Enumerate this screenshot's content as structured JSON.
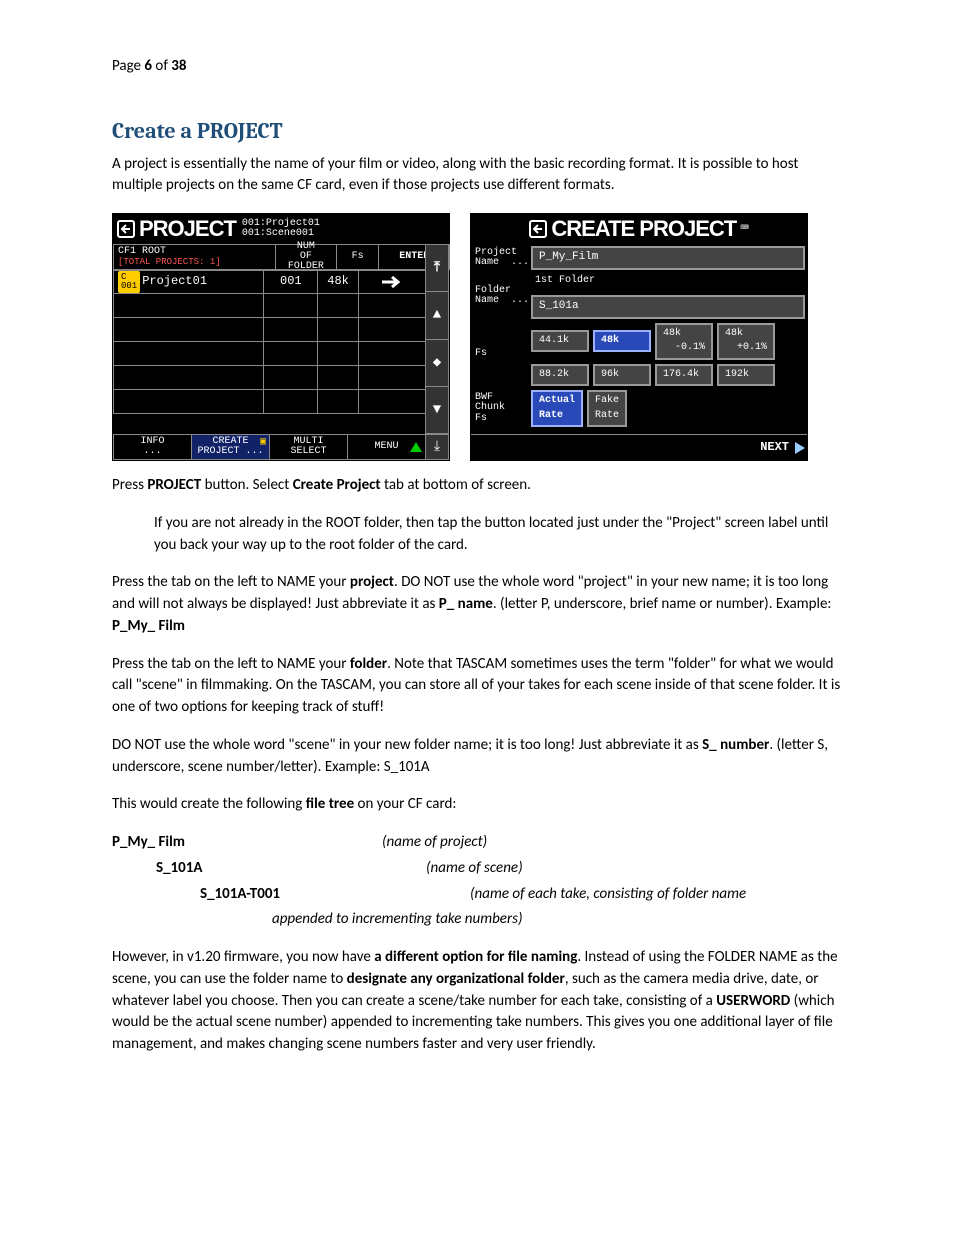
{
  "page": {
    "prefix": "Page ",
    "current": "6",
    "sep": " of ",
    "total": "38"
  },
  "heading": "Create a PROJECT",
  "intro": "A project is essentially the name of your film or video, along with the basic recording format. It is possible to host multiple projects on the same CF card, even if those projects use different formats.",
  "screen_left": {
    "title_big": "PROJECT",
    "title_sub1": "001:Project01",
    "title_sub2": "001:Scene001",
    "header": {
      "root_line1": "CF1 ROOT",
      "root_line2": "[TOTAL PROJECTS:  1]",
      "num_of_folder": "NUM\nOF\nFOLDER",
      "fs": "Fs",
      "enter": "ENTER"
    },
    "row1": {
      "badge": "C\n001",
      "name": "Project01",
      "num": "001",
      "fs": "48k"
    },
    "footer": {
      "info": "INFO\n...",
      "create": "CREATE\nPROJECT ...",
      "multi": "MULTI\nSELECT",
      "menu": "MENU"
    }
  },
  "screen_right": {
    "title_big": "CREATE PROJECT",
    "project_label": "Project\nName  ...",
    "project_value": "P_My_Film",
    "folder_label": "Folder\nName  ...",
    "folder_topline": "1st Folder",
    "folder_value": "S_101a",
    "fs_label": "Fs",
    "fs_opts": [
      "44.1k",
      "48k",
      "48k\n  -0.1%",
      "48k\n  +0.1%",
      "88.2k",
      "96k",
      "176.4k",
      "192k"
    ],
    "fs_selected_index": 1,
    "bwf_label": "BWF\nChunk\nFs",
    "bwf_opts": [
      "Actual\nRate",
      "Fake\nRate"
    ],
    "bwf_selected_index": 0,
    "next": "NEXT"
  },
  "p_press": {
    "a": "Press ",
    "b": "PROJECT",
    "c": " button. Select ",
    "d": "Create Project",
    "e": " tab at bottom of screen."
  },
  "p_root": "If you are not already in the ROOT folder, then tap the button located just under the \"Project\" screen label until you back your way up to the root folder of the card.",
  "p_name1": {
    "a": "Press the tab on the left to NAME your ",
    "b": "project",
    "c": ". DO NOT use the whole word \"project\" in your new name; it is too long and will not always be displayed! Just abbreviate it as ",
    "d": "P_ name",
    "e": ".  (letter P, underscore, brief name or number). Example: ",
    "f": "P_My_ Film"
  },
  "p_name2": {
    "a": "Press the tab on the left to NAME your ",
    "b": "folder",
    "c": ". Note that TASCAM sometimes uses the term \"folder\" for what we would call \"scene\" in filmmaking. On the TASCAM, you can store all of your takes for each scene inside of that scene folder. It is one of two options for keeping track of stuff!"
  },
  "p_scene": {
    "a": "DO NOT use the whole word \"scene\" in your new folder name; it is too long! Just abbreviate it as ",
    "b": "S_ number",
    "c": ".  (letter S, underscore, scene number/letter). Example: S_101A"
  },
  "p_tree_intro": {
    "a": "This would create the following ",
    "b": "file tree",
    "c": " on your CF card:"
  },
  "tree": {
    "l1": "P_My_ Film",
    "d1": "(name of project)",
    "l2": "S_101A",
    "d2": "(name of scene)",
    "l3": "S_101A-T001",
    "d3": "(name of each take, consisting of folder name",
    "d3b": "appended to incrementing take numbers)"
  },
  "p_firmware": {
    "a": "However, in v1.20 firmware, you now have ",
    "b": "a different option for file naming",
    "c": ". Instead of using the FOLDER NAME as the scene, you can use the folder name to ",
    "d": "designate any organizational folder",
    "e": ", such as the camera media drive, date, or whatever label you choose. Then you can create a scene/take number for each take, consisting of a ",
    "f": "USERWORD",
    "g": " (which would be the actual scene number) appended to incrementing take numbers. This gives you one additional layer of file management, and makes changing scene numbers faster and very user friendly."
  }
}
